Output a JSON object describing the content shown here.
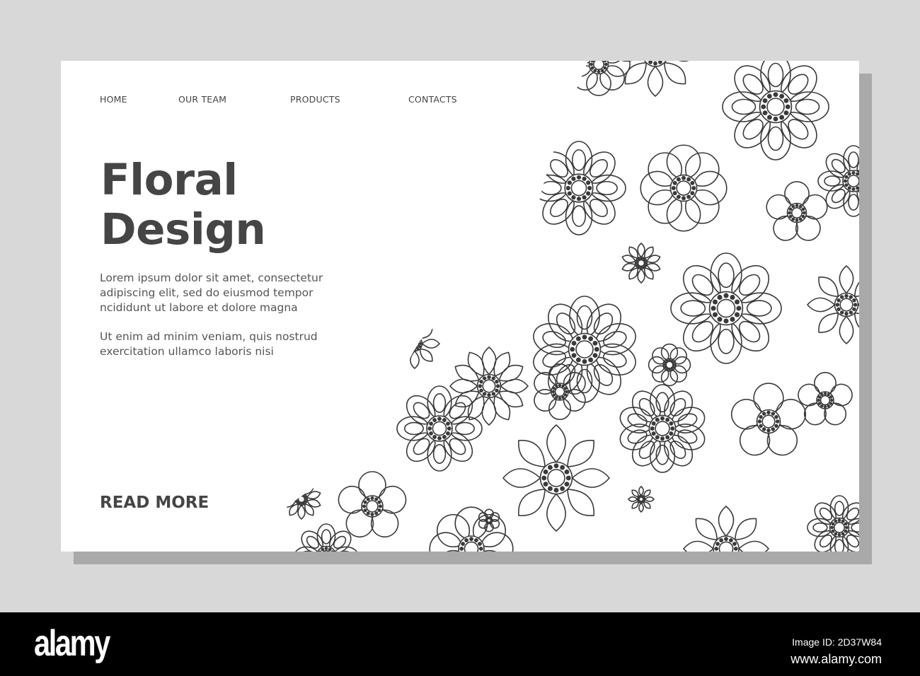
{
  "nav": {
    "items": [
      "HOME",
      "OUR TEAM",
      "PRODUCTS",
      "CONTACTS"
    ]
  },
  "hero": {
    "title_line1": "Floral",
    "title_line2": "Design",
    "paragraph1": "Lorem ipsum dolor sit amet, consectetur adipiscing elit, sed do eiusmod tempor ncididunt ut labore et dolore magna",
    "paragraph2": "Ut enim ad minim veniam, quis nostrud exercitation ullamco laboris nisi",
    "read_more": "READ MORE"
  },
  "watermark": {
    "logo": "alamy",
    "image_id": "Image ID: 2D37W84",
    "url": "www.alamy.com"
  },
  "colors": {
    "background": "#d8d8d8",
    "card": "#ffffff",
    "text": "#454545",
    "line_art": "#3a3a3a"
  }
}
